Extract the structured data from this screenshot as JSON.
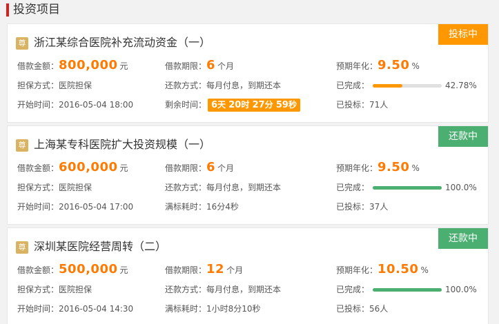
{
  "section": {
    "title": "投资项目"
  },
  "labels": {
    "zun": "尊",
    "amount": "借款金额：",
    "amount_unit": "元",
    "term": "借款期限：",
    "term_unit": "个月",
    "rate": "预期年化：",
    "rate_unit": "%",
    "guarantee": "担保方式：",
    "repay": "还款方式：",
    "done": "已完成：",
    "start": "开始时间：",
    "remain": "剩余时间：",
    "fill_time": "满标耗时：",
    "investors": "已投标："
  },
  "projects": [
    {
      "title": "浙江某综合医院补充流动资金（一）",
      "status": "投标中",
      "amount": "800,000",
      "term": "6",
      "rate": "9.50",
      "guarantee": "医院担保",
      "repay": "每月付息，到期还本",
      "progress": 42.78,
      "progress_text": "42.78%",
      "start": "2016-05-04 18:00",
      "countdown": {
        "d": "6",
        "du": "天",
        "h": "20",
        "hu": "时",
        "m": "27",
        "mu": "分",
        "s": "59",
        "su": "秒"
      },
      "investors": "71人"
    },
    {
      "title": "上海某专科医院扩大投资规模（一）",
      "status": "还款中",
      "amount": "600,000",
      "term": "6",
      "rate": "9.50",
      "guarantee": "医院担保",
      "repay": "每月付息，到期还本",
      "progress": 100,
      "progress_text": "100.0%",
      "start": "2016-05-04 17:00",
      "fill_time": "16分4秒",
      "investors": "37人"
    },
    {
      "title": "深圳某医院经营周转（二）",
      "status": "还款中",
      "amount": "500,000",
      "term": "12",
      "rate": "10.50",
      "guarantee": "医院担保",
      "repay": "每月付息，到期还本",
      "progress": 100,
      "progress_text": "100.0%",
      "start": "2016-05-04 14:30",
      "fill_time": "1小时8分10秒",
      "investors": "56人"
    }
  ],
  "colors": {
    "accent_orange": "#ff9800",
    "accent_green": "#4caf72",
    "amount_orange": "#ff7a00",
    "section_red": "#d71f1f",
    "zun_gold": "#d9b262"
  }
}
